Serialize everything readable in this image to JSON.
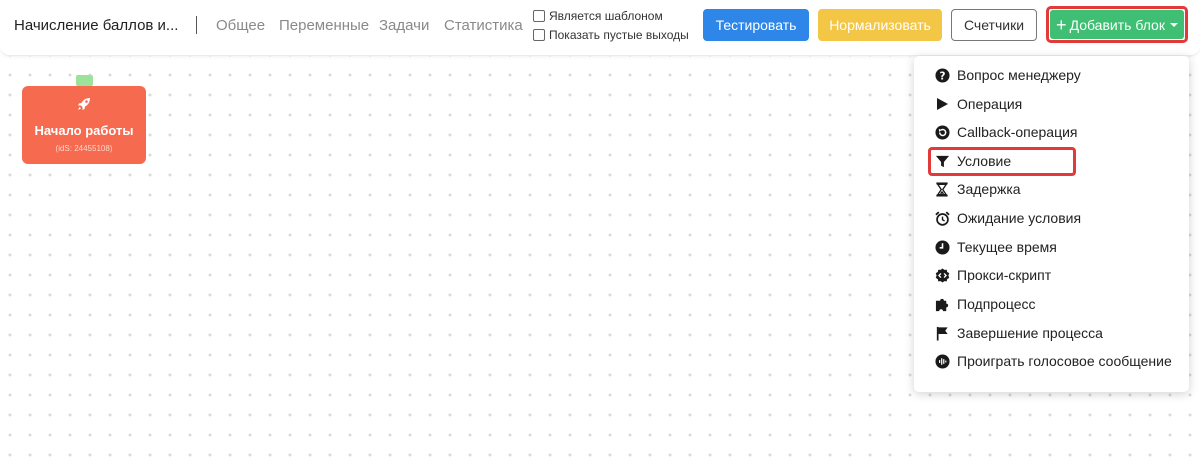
{
  "header": {
    "title": "Начисление баллов и...",
    "nav": [
      "Общее",
      "Переменные",
      "Задачи",
      "Статистика"
    ],
    "checkboxes": [
      "Является шаблоном",
      "Показать пустые выходы"
    ],
    "buttons": {
      "test": "Тестировать",
      "normalize": "Нормализовать",
      "counters": "Счетчики",
      "add_block": "Добавить блок"
    }
  },
  "canvas": {
    "start_node": {
      "title": "Начало работы",
      "id": "(idS: 24455108)",
      "color": "#f66a4f"
    }
  },
  "dropdown": {
    "items": [
      {
        "label": "Вопрос менеджеру",
        "icon": "question-circle-icon"
      },
      {
        "label": "Операция",
        "icon": "play-icon"
      },
      {
        "label": "Callback-операция",
        "icon": "undo-circle-icon"
      },
      {
        "label": "Условие",
        "icon": "filter-icon",
        "highlighted": true
      },
      {
        "label": "Задержка",
        "icon": "hourglass-icon"
      },
      {
        "label": "Ожидание условия",
        "icon": "alarm-clock-icon"
      },
      {
        "label": "Текущее время",
        "icon": "clock-icon"
      },
      {
        "label": "Прокси-скрипт",
        "icon": "code-badge-icon"
      },
      {
        "label": "Подпроцесс",
        "icon": "puzzle-icon"
      },
      {
        "label": "Завершение процесса",
        "icon": "flag-icon"
      },
      {
        "label": "Проиграть голосовое сообщение",
        "icon": "voice-message-icon"
      }
    ]
  },
  "colors": {
    "test_button": "#2d86e8",
    "normalize_button": "#f4c645",
    "add_block_button": "#3fbf73",
    "highlight": "#e23a3a"
  }
}
